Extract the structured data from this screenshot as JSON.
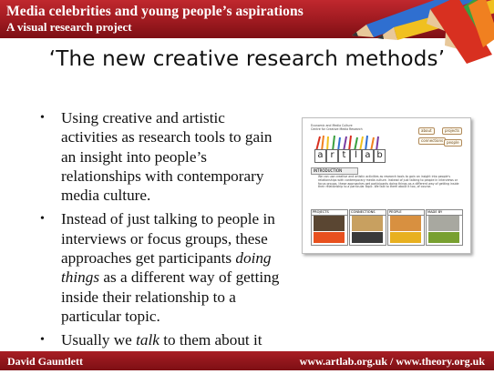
{
  "header": {
    "title": "Media celebrities and young people’s aspirations",
    "subtitle": "A visual research project"
  },
  "slide": {
    "title": "‘The new creative research methods’",
    "bullets": [
      {
        "before": "Using creative and artistic activities as research tools to gain an insight into people’s relationships with contemporary media culture.",
        "em": "",
        "after": ""
      },
      {
        "before": "Instead of just talking to people in interviews or focus groups, these approaches get participants ",
        "em": "doing things",
        "after": " as a different way of getting inside their relationship to a particular topic."
      },
      {
        "before": "Usually we ",
        "em": "talk",
        "after": " to them about it too."
      }
    ]
  },
  "thumbnail": {
    "header_lines": [
      "Economic and Media Culture",
      "Centre for Creative Media Research"
    ],
    "logo_letters": [
      "a",
      "r",
      "t",
      "l",
      "a",
      "b"
    ],
    "tags": [
      "about",
      "projects",
      "connections",
      "people"
    ],
    "intro_label": "INTRODUCTION",
    "intro_text": "We can use creative and artistic activities as research tools to gain an insight into people's relationships with contemporary media culture. Instead of just talking to people in interviews or focus groups, these approaches get participants doing things as a different way of getting inside their relationship to a particular topic. We talk to them about it too, of course.",
    "sections": [
      {
        "label": "PROJECTS",
        "color": "#e8501e",
        "img": "#5a4632"
      },
      {
        "label": "CONNECTIONS",
        "color": "#3a3a3a",
        "img": "#c8a060"
      },
      {
        "label": "PEOPLE",
        "color": "#e8b020",
        "img": "#d89040"
      },
      {
        "label": "MADE BY",
        "color": "#78a030",
        "img": "#a8a8a0"
      }
    ]
  },
  "footer": {
    "left": "David Gauntlett",
    "right": "www.artlab.org.uk / www.theory.org.uk"
  },
  "colors": {
    "header_red": "#9e1a20",
    "footer_red": "#7d0f14"
  }
}
